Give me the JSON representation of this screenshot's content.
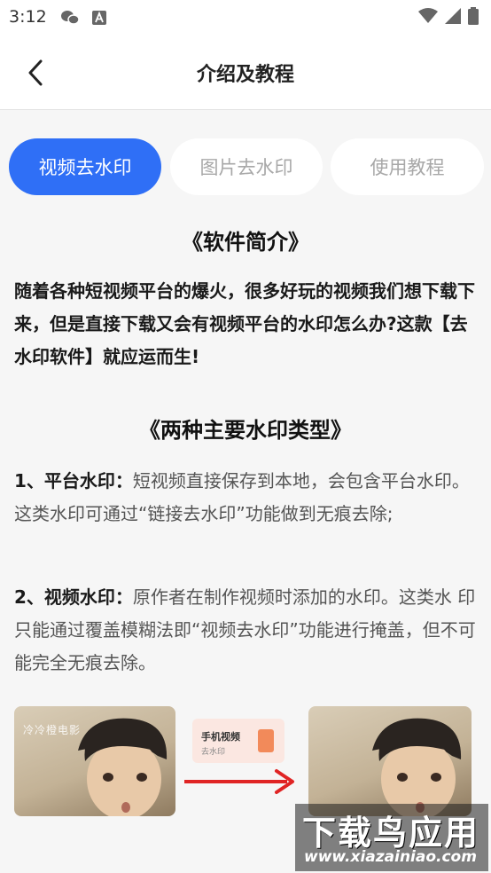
{
  "status_bar": {
    "time": "3:12",
    "notif_icons": [
      "wechat-icon",
      "app-a-icon"
    ],
    "right_icons": [
      "wifi-icon",
      "cellular-signal-icon",
      "battery-icon"
    ]
  },
  "nav": {
    "title": "介绍及教程"
  },
  "tabs": [
    {
      "label": "视频去水印",
      "active": true
    },
    {
      "label": "图片去水印",
      "active": false
    },
    {
      "label": "使用教程",
      "active": false
    }
  ],
  "content": {
    "intro_heading": "《软件简介》",
    "intro_text": "随着各种短视频平台的爆火，很多好玩的视频我们想下载下来，但是直接下载又会有视频平台的水印怎么办?这款【去水印软件】就应运而生!",
    "types_heading": "《两种主要水印类型》",
    "item1_label": "1、平台水印：",
    "item1_text": "短视频直接保存到本地，会包含平台水印。这类水印可通过“链接去水印”功能做到无痕去除;",
    "item2_label": "2、视频水印：",
    "item2_text": "原作者在制作视频时添加的水印。这类水 印只能通过覆盖模糊法即“视频去水印”功能进行掩盖，但不可能完全无痕去除。"
  },
  "illustration": {
    "watermark_text": "冷冷橙电影",
    "card_title": "手机视频",
    "card_subtitle": "去水印",
    "arrow_color": "#e02424"
  },
  "site_watermark": {
    "title": "下载鸟应用",
    "url": "www.xiazainiao.com"
  },
  "colors": {
    "accent": "#2f6ff6",
    "background": "#f6f6f6"
  }
}
